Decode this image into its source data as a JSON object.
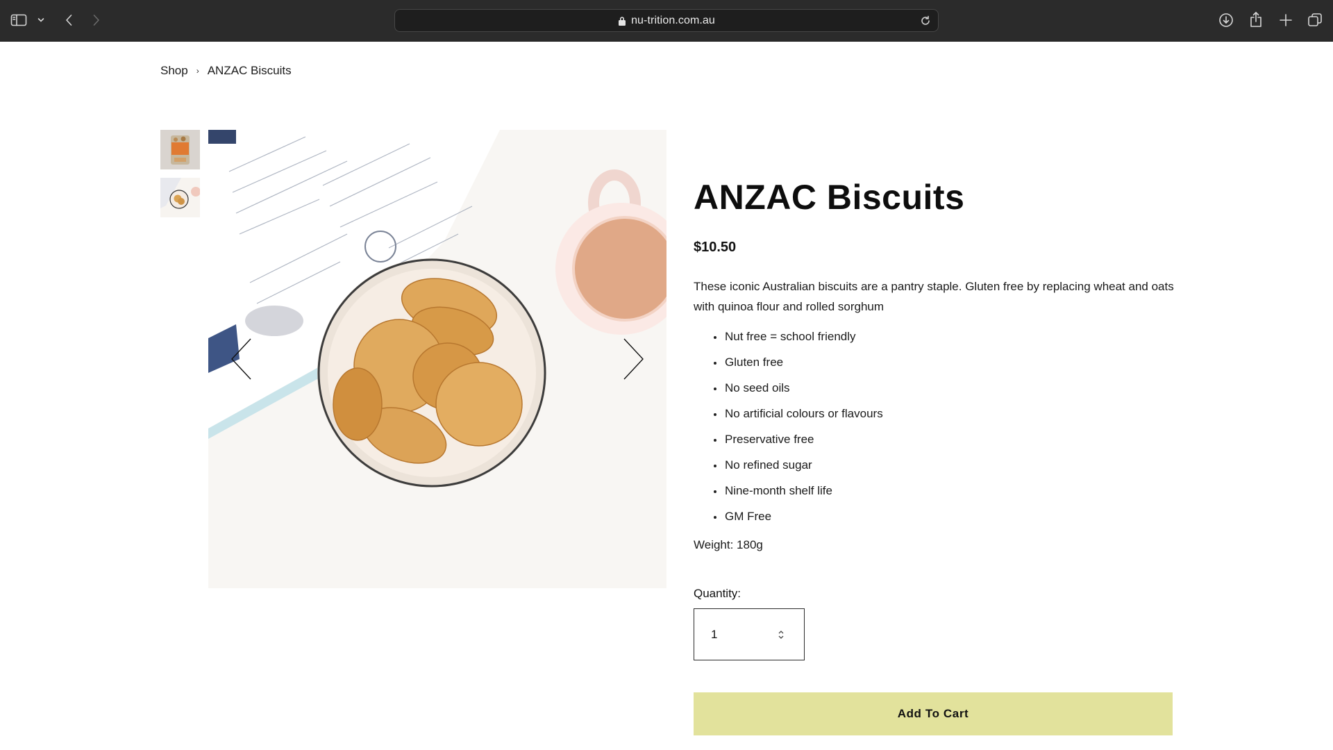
{
  "browser": {
    "url": "nu-trition.com.au",
    "icons": {
      "sidebar": "sidebar-icon",
      "tab_group_menu": "chevron-down-icon",
      "back": "back-icon",
      "forward": "forward-icon",
      "lock": "lock-icon",
      "reload": "reload-icon",
      "downloads": "download-icon",
      "share": "share-icon",
      "new_tab": "plus-icon",
      "tab_overview": "tabs-overview-icon"
    }
  },
  "breadcrumb": {
    "items": [
      "Shop",
      "ANZAC Biscuits"
    ],
    "separator": "›"
  },
  "gallery": {
    "thumbnails": [
      "product-packet-thumbnail",
      "biscuit-bowl-thumbnail"
    ],
    "main_image": "biscuits-in-bowl-with-tea",
    "prev_icon": "chevron-left-icon",
    "next_icon": "chevron-right-icon"
  },
  "product": {
    "title": "ANZAC Biscuits",
    "price": "$10.50",
    "description": "These iconic Australian biscuits are a pantry staple. Gluten free by replacing wheat and oats with quinoa flour and rolled sorghum",
    "features": [
      "Nut free = school friendly",
      "Gluten free",
      "No seed oils",
      "No artificial colours or flavours",
      "Preservative free",
      "No refined sugar",
      "Nine-month shelf life",
      "GM Free"
    ],
    "weight": "Weight: 180g"
  },
  "purchase": {
    "quantity_label": "Quantity:",
    "quantity_value": "1",
    "add_to_cart_label": "Add To Cart",
    "button_color": "#e2e29c"
  }
}
